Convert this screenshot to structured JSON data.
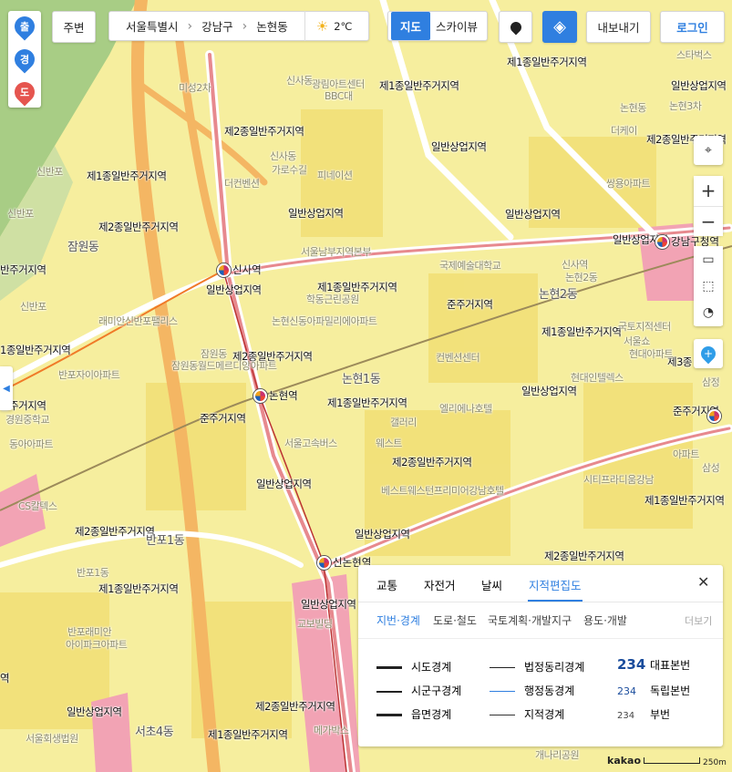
{
  "route": {
    "start": "출",
    "via": "경",
    "end": "도"
  },
  "toolbar": {
    "nearby": "주변",
    "breadcrumb": [
      "서울특별시",
      "강남구",
      "논현동"
    ],
    "weather_temp": "2℃",
    "map_tab": "지도",
    "skyview_tab": "스카이뷰",
    "export": "내보내기",
    "login": "로그인"
  },
  "colors": {
    "accent": "#2f7fe0",
    "residential": "#f5eb9c",
    "commercial": "#f0a0b0",
    "park": "#c9dca3",
    "road": "#f3b25f"
  },
  "map_labels": {
    "zones": [
      {
        "text": "제1종일반주거지역"
      },
      {
        "text": "제1종일반주거지역"
      },
      {
        "text": "일반상업지역"
      },
      {
        "text": "제2종일반주거지역"
      },
      {
        "text": "일반상업지역"
      },
      {
        "text": "제2종일반주거지역"
      },
      {
        "text": "제1종일반주거지역"
      },
      {
        "text": "일반상업지역"
      },
      {
        "text": "일반상업지역"
      },
      {
        "text": "제2종일반주거지역"
      },
      {
        "text": "일반상업지역"
      },
      {
        "text": "반주거지역"
      },
      {
        "text": "일반상업지역"
      },
      {
        "text": "제1종일반주거지역"
      },
      {
        "text": "준주거지역"
      },
      {
        "text": "제1종일반주거지역"
      },
      {
        "text": "1종일반주거지역"
      },
      {
        "text": "제2종일반주거지역"
      },
      {
        "text": "제3종"
      },
      {
        "text": "제1종일반주거지역"
      },
      {
        "text": "일반상업지역"
      },
      {
        "text": "반주거지역"
      },
      {
        "text": "준주거지역"
      },
      {
        "text": "준주거지역"
      },
      {
        "text": "제2종일반주거지역"
      },
      {
        "text": "일반상업지역"
      },
      {
        "text": "제1종일반주거지역"
      },
      {
        "text": "제2종일반주거지역"
      },
      {
        "text": "일반상업지역"
      },
      {
        "text": "제2종일반주거지역"
      },
      {
        "text": "제1종일반주거지역"
      },
      {
        "text": "일반상업지역"
      },
      {
        "text": "역"
      },
      {
        "text": "일반상업지역"
      },
      {
        "text": "제2종일반주거지역"
      },
      {
        "text": "제1종일반주거지역"
      }
    ],
    "dongs": [
      {
        "text": "잠원동"
      },
      {
        "text": "논현2동"
      },
      {
        "text": "논현1동"
      },
      {
        "text": "반포1동"
      },
      {
        "text": "서초4동"
      }
    ],
    "stations": [
      {
        "text": "신사역"
      },
      {
        "text": "논현역"
      },
      {
        "text": "신논현역"
      },
      {
        "text": "강남구청역"
      }
    ],
    "places": [
      {
        "text": "미성2차"
      },
      {
        "text": "신사동"
      },
      {
        "text": "BBC대"
      },
      {
        "text": "광림아트센터"
      },
      {
        "text": "신사동"
      },
      {
        "text": "가로수길"
      },
      {
        "text": "피네이션"
      },
      {
        "text": "더컨벤션"
      },
      {
        "text": "국제예술대학교"
      },
      {
        "text": "서울남부지역본부"
      },
      {
        "text": "학동근린공원"
      },
      {
        "text": "논현신동아파밀리에아파트"
      },
      {
        "text": "잠원동"
      },
      {
        "text": "잠원동월드메르디앙아파트"
      },
      {
        "text": "래미안신반포팰리스"
      },
      {
        "text": "반포자이아파트"
      },
      {
        "text": "서울고속버스"
      },
      {
        "text": "컨벤션센터"
      },
      {
        "text": "현대인텔렉스"
      },
      {
        "text": "엘리에나호텔"
      },
      {
        "text": "웨스트"
      },
      {
        "text": "베스트웨스턴프리미어강남호텔"
      },
      {
        "text": "시티프라디움강남"
      },
      {
        "text": "교보빌딩"
      },
      {
        "text": "메가박스"
      },
      {
        "text": "서울회생법원"
      },
      {
        "text": "개나리공원"
      },
      {
        "text": "CS칼텍스"
      },
      {
        "text": "반포래미안"
      },
      {
        "text": "아이파크아파트"
      },
      {
        "text": "신사역"
      },
      {
        "text": "논현2동"
      },
      {
        "text": "갤러리"
      },
      {
        "text": "더케이"
      },
      {
        "text": "쌍용아파트"
      },
      {
        "text": "스타벅스"
      },
      {
        "text": "논현3차"
      },
      {
        "text": "논현동"
      },
      {
        "text": "삼정"
      },
      {
        "text": "국토지적센터"
      },
      {
        "text": "현대아파트"
      },
      {
        "text": "삼성"
      },
      {
        "text": "아파트"
      },
      {
        "text": "서울쇼"
      },
      {
        "text": "신반포"
      },
      {
        "text": "신반포"
      },
      {
        "text": "경원중학교"
      },
      {
        "text": "동아아파트"
      },
      {
        "text": "신반포"
      },
      {
        "text": "반포1동"
      }
    ]
  },
  "map_tools": {
    "zoom_in": "+",
    "zoom_out": "−"
  },
  "layer_panel": {
    "tabs": [
      "교통",
      "자전거",
      "날씨",
      "지적편집도"
    ],
    "active_tab": "지적편집도",
    "subtabs": [
      "지번·경계",
      "도로·철도",
      "국토계획·개발지구",
      "용도·개발"
    ],
    "active_subtab": "지번·경계",
    "more": "더보기",
    "legend": [
      {
        "label": "시도경계"
      },
      {
        "label": "시군구경계"
      },
      {
        "label": "읍면경계"
      },
      {
        "label": "법정동리경계"
      },
      {
        "label": "행정동경계"
      },
      {
        "label": "지적경계"
      },
      {
        "number": "234",
        "label": "대표본번"
      },
      {
        "number": "234",
        "label": "독립본번"
      },
      {
        "number": "234",
        "label": "부번"
      }
    ]
  },
  "scale": {
    "brand": "kakao",
    "distance": "250m"
  }
}
